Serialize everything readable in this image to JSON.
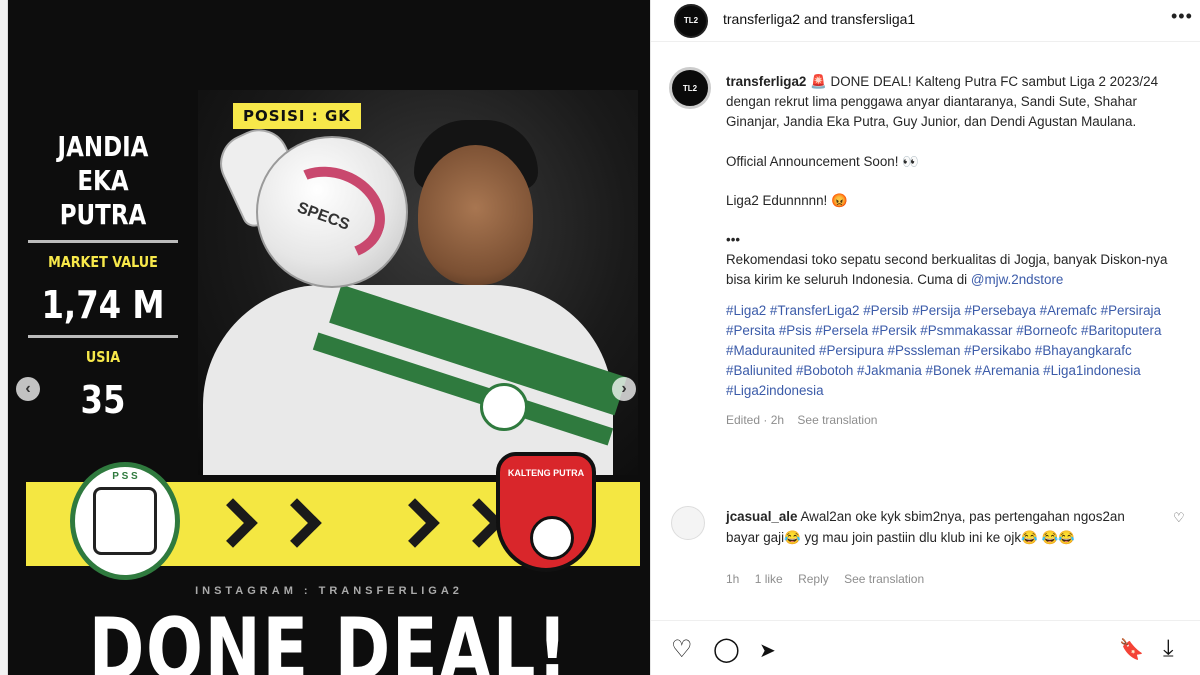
{
  "image": {
    "player_name_line1": "JANDIA",
    "player_name_line2": "EKA PUTRA",
    "market_value_label": "MARKET VALUE",
    "market_value": "1,74 M",
    "age_label": "USIA",
    "age": "35",
    "position_label": "POSISI : GK",
    "ball_brand": "SPECS",
    "from_club_logo_text": "P S S",
    "to_club_logo_text": "KALTENG PUTRA",
    "instagram_handle_text": "INSTAGRAM : TRANSFERLIGA2",
    "headline": "DONE DEAL!",
    "prev_arrow": "‹",
    "next_arrow": "›"
  },
  "header": {
    "avatar_text": "TL2",
    "title": "transferliga2 and transfersliga1",
    "more_icon": "•••"
  },
  "caption": {
    "avatar_text": "TL2",
    "username": "transferliga2",
    "emoji_alarm": "🚨",
    "text_main": "DONE DEAL! Kalteng Putra FC sambut Liga 2 2023/24 dengan rekrut lima penggawa anyar diantaranya, Sandi Sute, Shahar Ginanjar, Jandia Eka Putra, Guy Junior, dan Dendi Agustan Maulana.",
    "announcement": "Official Announcement Soon! 👀",
    "liga2": "Liga2 Edunnnnn! 😡",
    "dots": "•••",
    "recommendation": "Rekomendasi toko sepatu second berkualitas di Jogja, banyak Diskon-nya bisa kirim ke seluruh Indonesia. Cuma di",
    "store_link": "@mjw.2ndstore",
    "hashtags": "#Liga2 #TransferLiga2 #Persib #Persija #Persebaya #Aremafc #Persiraja #Persita #Psis #Persela #Persik #Psmmakassar #Borneofc #Baritoputera #Maduraunited #Persipura #Psssleman #Persikabo #Bhayangkarafc #Baliunited #Bobotoh #Jakmania #Bonek #Aremania #Liga1indonesia #Liga2indonesia",
    "edited": "Edited · 2h",
    "see_translation": "See translation"
  },
  "comment": {
    "username": "jcasual_ale",
    "text": "Awal2an oke kyk sbim2nya, pas pertengahan ngos2an bayar gaji😂 yg mau join pastiin dlu klub ini ke ojk😂 😂😂",
    "time": "1h",
    "likes": "1 like",
    "reply": "Reply",
    "see_translation": "See translation",
    "heart_icon": "♡"
  },
  "actions": {
    "like_icon": "♡",
    "comment_icon": "◯",
    "share_icon": "➤",
    "save_icon": "🔖",
    "download_icon": "⤓"
  }
}
